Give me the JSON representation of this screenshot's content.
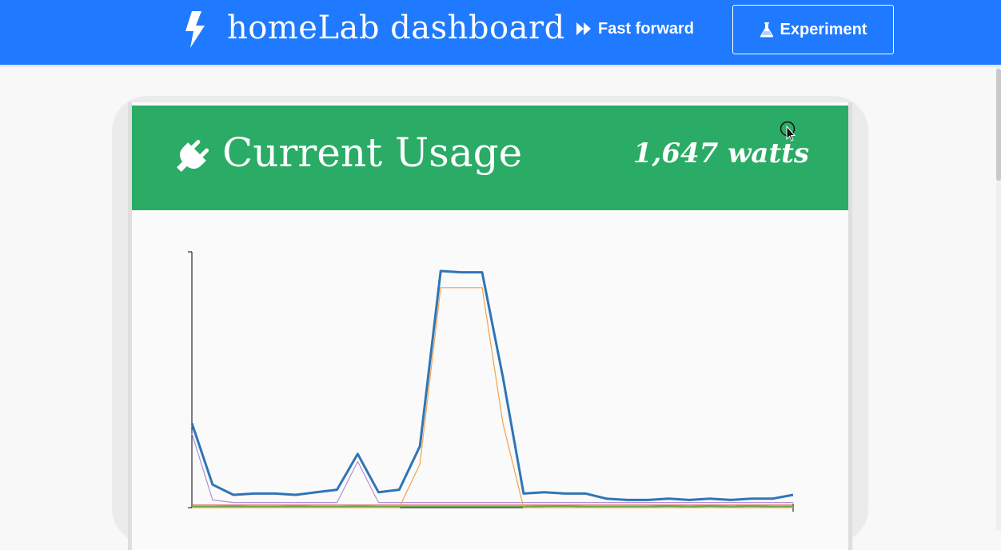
{
  "navbar": {
    "brand_icon": "lightning-bolt-icon",
    "title": "homeLab dashboard",
    "fast_forward_label": "Fast forward",
    "fast_forward_icon": "fast-forward-icon",
    "experiment_label": "Experiment",
    "experiment_icon": "flask-icon",
    "background": "#1f7aff"
  },
  "card": {
    "icon": "plug-icon",
    "title": "Current Usage",
    "value": "1,647 watts",
    "header_color": "#2aab66"
  },
  "chart_data": {
    "type": "line",
    "x": [
      0,
      1,
      2,
      3,
      4,
      5,
      6,
      7,
      8,
      9,
      10,
      11,
      12,
      13,
      14,
      15,
      16,
      17,
      18,
      19,
      20,
      21,
      22,
      23,
      24,
      25,
      26,
      27,
      28,
      29
    ],
    "ylim": [
      0,
      100
    ],
    "series": [
      {
        "color": "#2e75b6",
        "values": [
          33,
          9,
          5,
          5.5,
          5.5,
          5,
          6,
          7,
          21,
          6,
          7,
          24,
          92.5,
          92,
          92,
          51,
          5.5,
          6,
          5.5,
          5.5,
          3.5,
          3,
          3,
          3.5,
          3,
          3.5,
          3,
          3.5,
          3.5,
          5
        ]
      },
      {
        "color": "#f5a04a",
        "values": [
          0,
          0,
          0,
          0,
          0,
          0,
          0,
          0,
          0,
          0,
          0,
          17,
          86,
          86,
          86,
          33,
          0,
          0,
          0,
          0,
          0,
          0,
          0,
          0,
          0,
          0,
          0,
          0,
          0,
          0
        ]
      },
      {
        "color": "#b48fd6",
        "values": [
          29,
          3,
          2,
          2,
          2,
          2,
          2,
          2,
          18,
          2,
          2,
          2,
          2,
          2,
          2,
          2,
          2,
          2,
          2,
          2,
          2,
          2,
          2,
          2,
          2,
          2,
          2,
          2,
          2,
          2
        ]
      },
      {
        "color": "#d9534f",
        "values": [
          1,
          1,
          1,
          1,
          1,
          1,
          1,
          1,
          1,
          1,
          1,
          1,
          1,
          1,
          1,
          1,
          1,
          1,
          1,
          1,
          1,
          1,
          1,
          1,
          1,
          1,
          1,
          1,
          1,
          1
        ]
      },
      {
        "color": "#6aa84f",
        "values": [
          0.4,
          0.4,
          0.5,
          0.4,
          0.4,
          0.5,
          0.4,
          0.4,
          0.5,
          0.4,
          0.4,
          0.4,
          0.4,
          0.4,
          0.4,
          0.4,
          0.4,
          0.5,
          0.6,
          0.4,
          0.4,
          0.4,
          0.4,
          0.6,
          0.4,
          0.6,
          0.4,
          0.6,
          0.4,
          0.4
        ]
      }
    ]
  }
}
